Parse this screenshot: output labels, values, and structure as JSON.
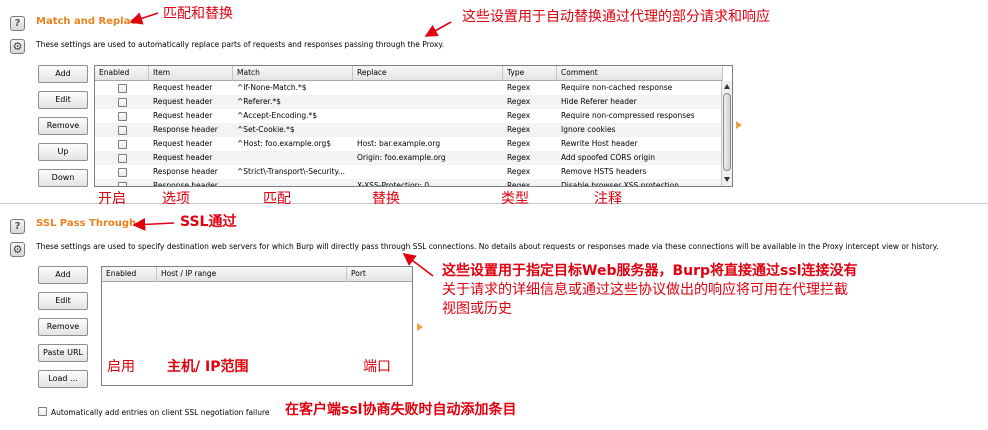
{
  "match_replace": {
    "title": "Match and Replace",
    "description": "These settings are used to automatically replace parts of requests and responses passing through the Proxy.",
    "buttons": [
      "Add",
      "Edit",
      "Remove",
      "Up",
      "Down"
    ],
    "columns": [
      "Enabled",
      "Item",
      "Match",
      "Replace",
      "Type",
      "Comment"
    ],
    "rows": [
      {
        "item": "Request header",
        "match": "^If-None-Match.*$",
        "replace": "",
        "type": "Regex",
        "comment": "Require non-cached response"
      },
      {
        "item": "Request header",
        "match": "^Referer.*$",
        "replace": "",
        "type": "Regex",
        "comment": "Hide Referer header"
      },
      {
        "item": "Request header",
        "match": "^Accept-Encoding.*$",
        "replace": "",
        "type": "Regex",
        "comment": "Require non-compressed responses"
      },
      {
        "item": "Response header",
        "match": "^Set-Cookie.*$",
        "replace": "",
        "type": "Regex",
        "comment": "Ignore cookies"
      },
      {
        "item": "Request header",
        "match": "^Host: foo.example.org$",
        "replace": "Host: bar.example.org",
        "type": "Regex",
        "comment": "Rewrite Host header"
      },
      {
        "item": "Request header",
        "match": "",
        "replace": "Origin: foo.example.org",
        "type": "Regex",
        "comment": "Add spoofed CORS origin"
      },
      {
        "item": "Response header",
        "match": "^Strict\\-Transport\\-Security...",
        "replace": "",
        "type": "Regex",
        "comment": "Remove HSTS headers"
      },
      {
        "item": "Response header",
        "match": "",
        "replace": "X-XSS-Protection: 0",
        "type": "Regex",
        "comment": "Disable browser XSS protection"
      }
    ]
  },
  "ssl_pass": {
    "title": "SSL Pass Through",
    "description": "These settings are used to specify destination web servers for which Burp will directly pass through SSL connections. No details about requests or responses made via these connections will be available in the Proxy intercept view or history.",
    "buttons": [
      "Add",
      "Edit",
      "Remove",
      "Paste URL",
      "Load ..."
    ],
    "columns": [
      "Enabled",
      "Host / IP range",
      "Port"
    ],
    "auto_add_label": "Automatically add entries on client SSL negotiation failure"
  },
  "annotations": {
    "match_title": "匹配和替换",
    "match_desc": "这些设置用于自动替换通过代理的部分请求和响应",
    "col_enabled": "开启",
    "col_item": "选项",
    "col_match": "匹配",
    "col_replace": "替换",
    "col_type": "类型",
    "col_comment": "注释",
    "ssl_title": "SSL通过",
    "ssl_desc_1": "这些设置用于指定目标Web服务器，Burp将直接通过ssl连接没有",
    "ssl_desc_2": "关于请求的详细信息或通过这些协议做出的响应将可用在代理拦截",
    "ssl_desc_3": "视图或历史",
    "ssl_enabled": "启用",
    "ssl_host": "主机/ IP范围",
    "ssl_port": "端口",
    "auto_add": "在客户端ssl协商失败时自动添加条目"
  },
  "colors": {
    "section_title": "#e8821e",
    "annotation": "#e0000f"
  }
}
